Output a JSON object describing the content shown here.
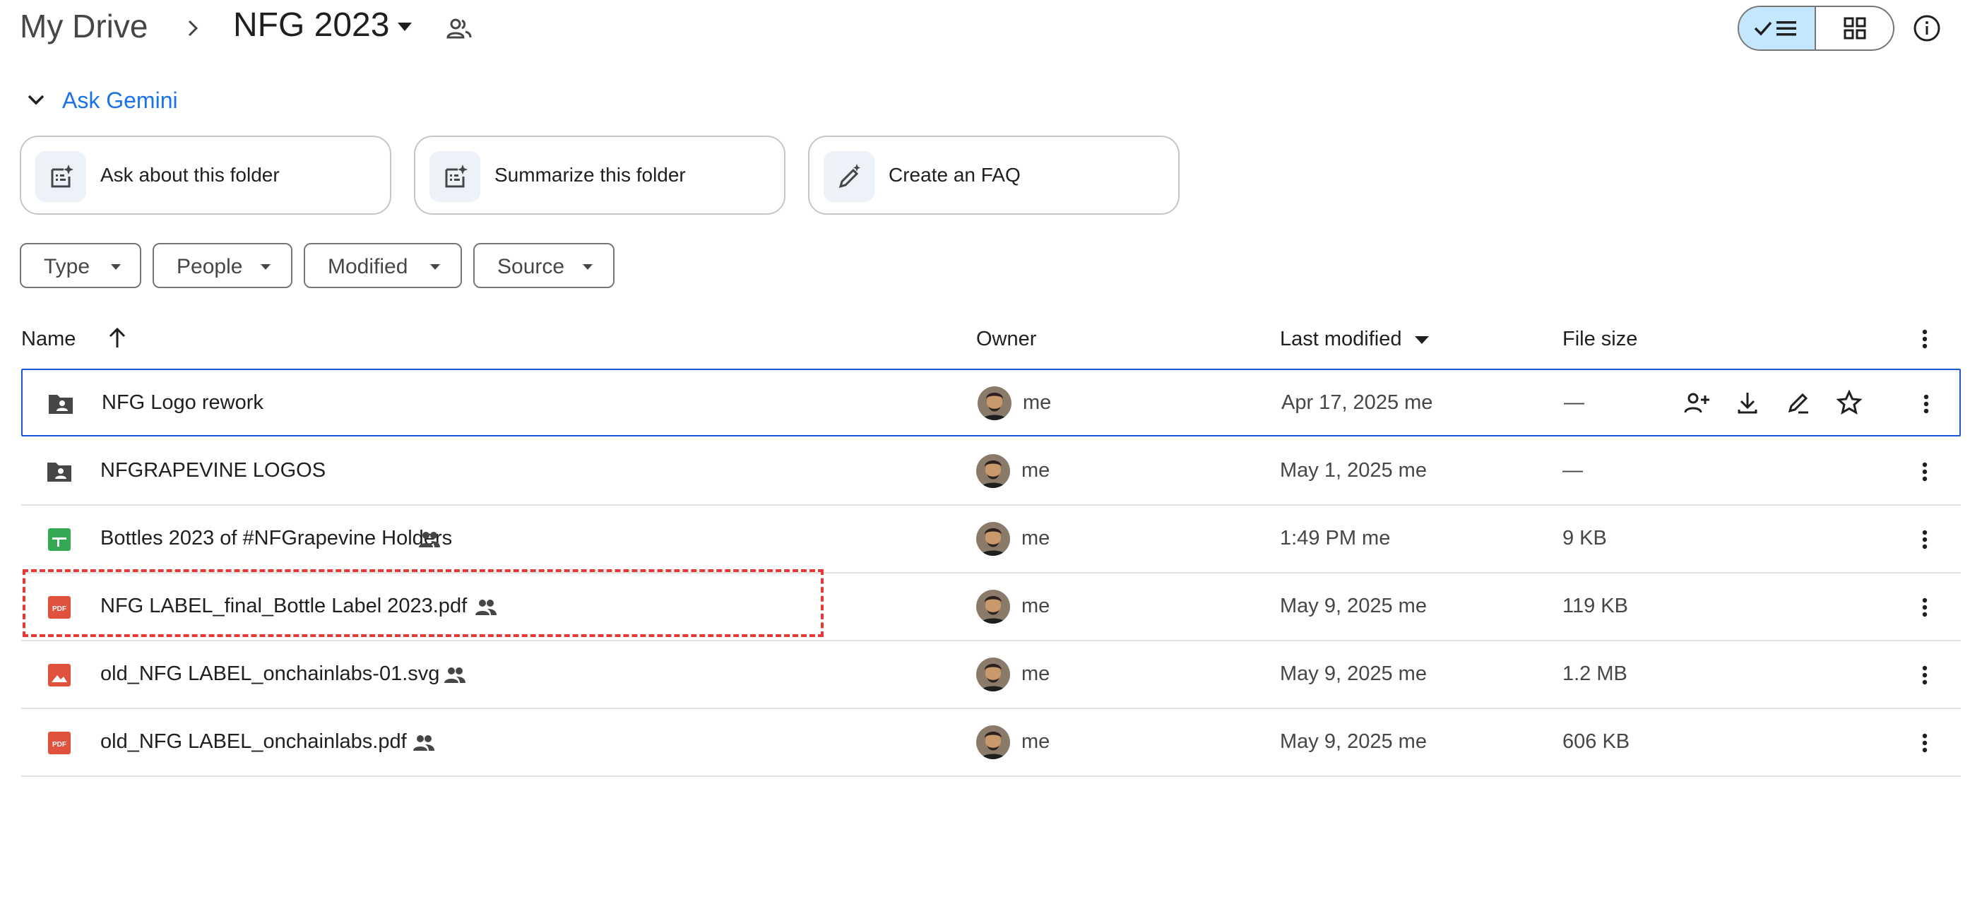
{
  "breadcrumb": {
    "root": "My Drive",
    "current": "NFG 2023"
  },
  "gemini": {
    "label": "Ask Gemini",
    "cards": [
      {
        "label": "Ask about this folder",
        "icon": "ask-folder-icon"
      },
      {
        "label": "Summarize this folder",
        "icon": "summarize-icon"
      },
      {
        "label": "Create an FAQ",
        "icon": "pen-sparkle-icon"
      }
    ]
  },
  "filters": [
    "Type",
    "People",
    "Modified",
    "Source"
  ],
  "table": {
    "headers": {
      "name": "Name",
      "owner": "Owner",
      "modified": "Last modified",
      "size": "File size"
    },
    "rows": [
      {
        "name": "NFG Logo rework",
        "type": "shared-folder",
        "shared": false,
        "owner": "me",
        "modified": "Apr 17, 2025 me",
        "size": "—",
        "selected": true
      },
      {
        "name": "NFGRAPEVINE LOGOS",
        "type": "shared-folder",
        "shared": false,
        "owner": "me",
        "modified": "May 1, 2025 me",
        "size": "—",
        "selected": false
      },
      {
        "name": "Bottles 2023 of #NFGrapevine Holders",
        "type": "sheet",
        "shared": true,
        "owner": "me",
        "modified": "1:49 PM me",
        "size": "9 KB",
        "selected": false
      },
      {
        "name": "NFG LABEL_final_Bottle Label 2023.pdf",
        "type": "pdf",
        "shared": true,
        "owner": "me",
        "modified": "May 9, 2025 me",
        "size": "119 KB",
        "selected": false
      },
      {
        "name": "old_NFG LABEL_onchainlabs-01.svg",
        "type": "image",
        "shared": true,
        "owner": "me",
        "modified": "May 9, 2025 me",
        "size": "1.2 MB",
        "selected": false
      },
      {
        "name": "old_NFG LABEL_onchainlabs.pdf",
        "type": "pdf",
        "shared": true,
        "owner": "me",
        "modified": "May 9, 2025 me",
        "size": "606 KB",
        "selected": false
      }
    ]
  },
  "colors": {
    "accent": "#1a73e8",
    "selected_view": "#c2e7ff",
    "pdf": "#e0513e",
    "sheet": "#34a853",
    "highlight": "#e53935"
  },
  "pdf_badge": "PDF"
}
